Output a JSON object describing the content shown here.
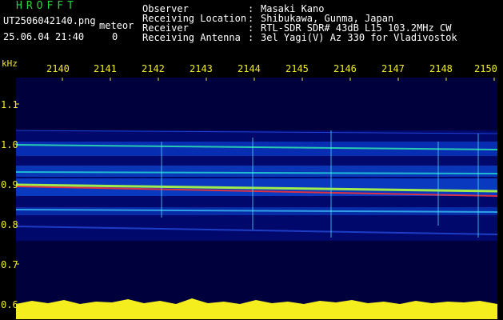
{
  "header": {
    "app_title": "HROFFT",
    "filename": "UT2506042140.png",
    "meteor_label": "meteor",
    "datetime": "25.06.04 21:40",
    "count": "0"
  },
  "info": [
    {
      "label": "Observer",
      "value": "Masaki Kano"
    },
    {
      "label": "Receiving Location",
      "value": "Shibukawa, Gunma, Japan"
    },
    {
      "label": "Receiver",
      "value": "RTL-SDR SDR# 43dB L15 103.2MHz CW"
    },
    {
      "label": "Receiving Antenna",
      "value": "3el Yagi(V) Az 330 for Vladivostok"
    }
  ],
  "colon": ":",
  "axis": {
    "unit": "kHz",
    "x_ticks": [
      "2140",
      "2141",
      "2142",
      "2143",
      "2144",
      "2145",
      "2146",
      "2147",
      "2148",
      "2150"
    ],
    "y_ticks": [
      "1.1",
      "1.0",
      "0.9",
      "0.8",
      "0.7",
      "0.6"
    ]
  },
  "colors": {
    "background": "#000000",
    "spectrogram_bg": "#00003c",
    "tick_text": "#f2ea2a",
    "label_text": "#ffffff",
    "title_text": "#22d63a",
    "noise_floor": "#f5ee1e"
  }
}
